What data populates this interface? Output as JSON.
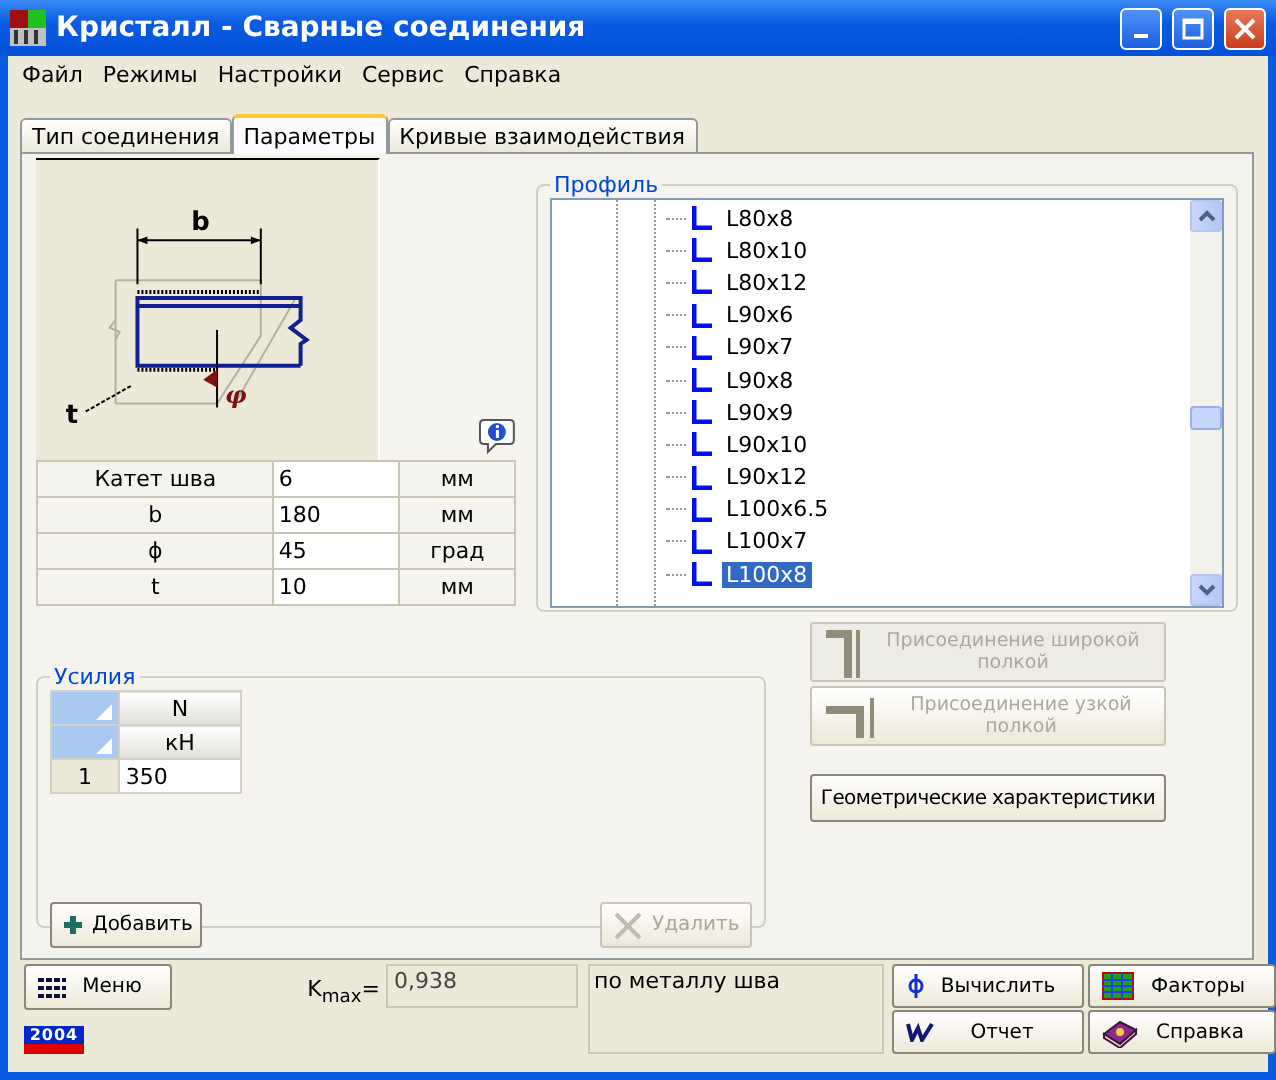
{
  "window": {
    "title": "Кристалл - Сварные соединения"
  },
  "menu": [
    "Файл",
    "Режимы",
    "Настройки",
    "Сервис",
    "Справка"
  ],
  "tabs": [
    {
      "label": "Тип соединения",
      "selected": false
    },
    {
      "label": "Параметры",
      "selected": true
    },
    {
      "label": "Кривые взаимодействия",
      "selected": false
    }
  ],
  "diagram": {
    "b_label": "b",
    "t_label": "t",
    "angle_label": "φ"
  },
  "parameters": [
    {
      "name": "Катет шва",
      "value": "6",
      "unit": "мм"
    },
    {
      "name": "b",
      "value": "180",
      "unit": "мм"
    },
    {
      "name": "ϕ",
      "value": "45",
      "unit": "град"
    },
    {
      "name": "t",
      "value": "10",
      "unit": "мм"
    }
  ],
  "profile": {
    "title": "Профиль",
    "items": [
      {
        "label": "L80x8",
        "selected": false
      },
      {
        "label": "L80x10",
        "selected": false
      },
      {
        "label": "L80x12",
        "selected": false
      },
      {
        "label": "L90x6",
        "selected": false
      },
      {
        "label": "L90x7",
        "selected": false
      },
      {
        "label": "L90x8",
        "selected": false
      },
      {
        "label": "L90x9",
        "selected": false
      },
      {
        "label": "L90x10",
        "selected": false
      },
      {
        "label": "L90x12",
        "selected": false
      },
      {
        "label": "L100x6.5",
        "selected": false
      },
      {
        "label": "L100x7",
        "selected": false
      },
      {
        "label": "L100x8",
        "selected": true
      }
    ]
  },
  "forces": {
    "title": "Усилия",
    "columns": [
      {
        "name": "N",
        "unit": "кН"
      }
    ],
    "rows": [
      {
        "index": "1",
        "values": [
          "350"
        ]
      }
    ],
    "add_button": {
      "label": "Добавить",
      "disabled": false
    },
    "delete_button": {
      "label": "Удалить",
      "disabled": true
    }
  },
  "connection_buttons": [
    {
      "label": "Присоединение широкой полкой",
      "kind": "wide",
      "disabled": true
    },
    {
      "label": "Присоединение узкой полкой",
      "kind": "narrow",
      "disabled": true
    }
  ],
  "geometry_button": {
    "label": "Геометрические характеристики",
    "disabled": false
  },
  "bottom": {
    "menu_button": "Меню",
    "badge": "2004",
    "kmax_label": "K$_{max}$=",
    "kmax_value": "0,938",
    "result_text": "по металлу шва",
    "buttons": [
      {
        "label": "Вычислить",
        "kind": "calc"
      },
      {
        "label": "Отчет",
        "kind": "report"
      },
      {
        "label": "Факторы",
        "kind": "factors"
      },
      {
        "label": "Справка",
        "kind": "help"
      }
    ]
  }
}
